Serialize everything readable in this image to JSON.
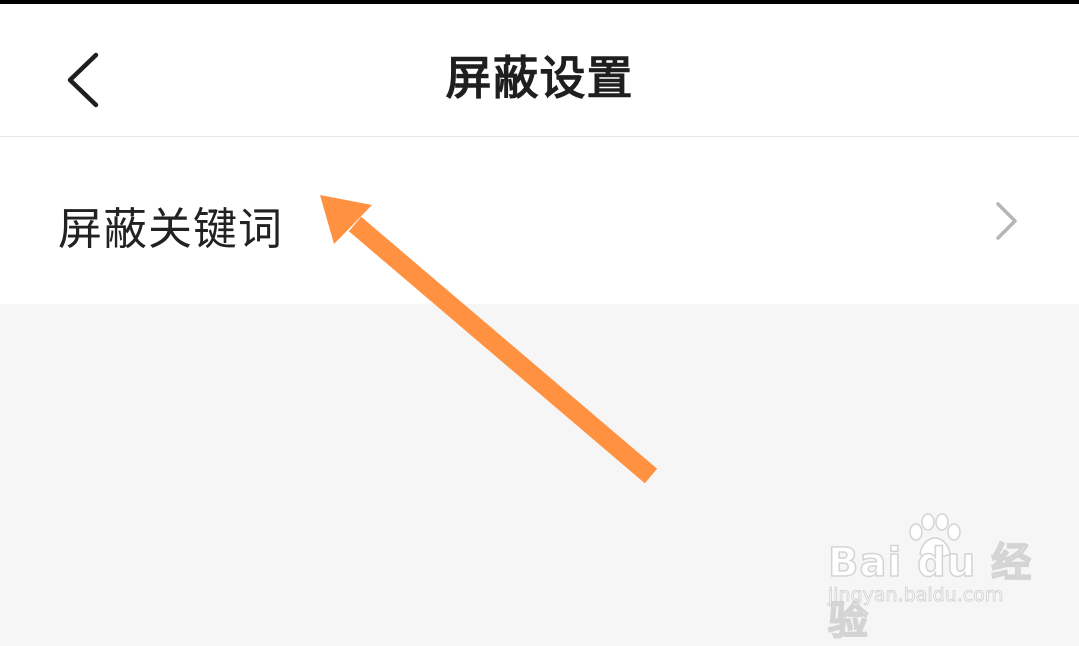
{
  "header": {
    "title": "屏蔽设置",
    "back_icon": "chevron-left"
  },
  "settings": {
    "items": [
      {
        "label": "屏蔽关键词",
        "trailing_icon": "chevron-right"
      }
    ]
  },
  "annotation": {
    "arrow_color": "#ff9140",
    "pointing_to": "屏蔽关键词"
  },
  "watermark": {
    "logo": "Bai du 经验",
    "url": "jingyan.baidu.com"
  },
  "colors": {
    "background": "#f6f6f6",
    "surface": "#ffffff",
    "text": "#222222",
    "chevron": "#b5b5b5"
  }
}
